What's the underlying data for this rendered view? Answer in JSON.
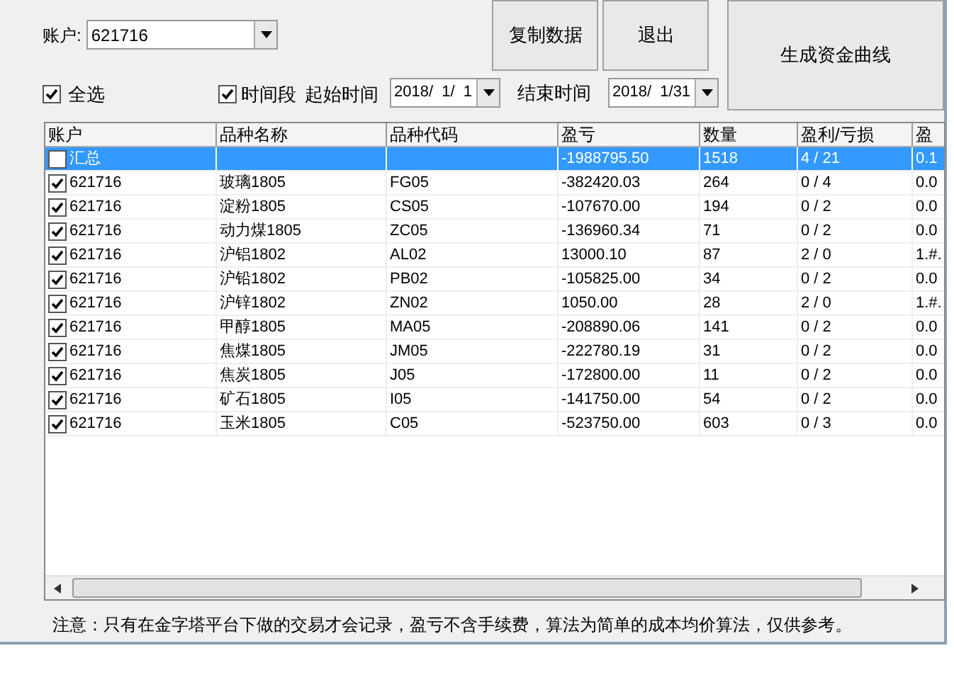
{
  "account": {
    "label": "账户:",
    "value": "621716"
  },
  "buttons": [
    {
      "label": "复制数据",
      "kind": "small"
    },
    {
      "label": "退出",
      "kind": "small"
    },
    {
      "label": "生成资金曲线",
      "kind": "large"
    }
  ],
  "select_all": {
    "label": "全选",
    "checked": true
  },
  "period": {
    "label": "时间段",
    "checked": true,
    "start_label": "起始时间",
    "start": "2018/  1/  1",
    "end_label": "结束时间",
    "end": "2018/  1/31"
  },
  "table": {
    "columns": [
      "账户",
      "品种名称",
      "品种代码",
      "盈亏",
      "数量",
      "盈利/亏损",
      "盈"
    ],
    "rows": [
      {
        "checked": false,
        "selected": true,
        "cells": [
          "汇总",
          "",
          "",
          "-1988795.50",
          "1518",
          "4 / 21",
          "0.1"
        ]
      },
      {
        "checked": true,
        "selected": false,
        "cells": [
          "621716",
          "玻璃1805",
          "FG05",
          "-382420.03",
          "264",
          "0 / 4",
          "0.0"
        ]
      },
      {
        "checked": true,
        "selected": false,
        "cells": [
          "621716",
          "淀粉1805",
          "CS05",
          "-107670.00",
          "194",
          "0 / 2",
          "0.0"
        ]
      },
      {
        "checked": true,
        "selected": false,
        "cells": [
          "621716",
          "动力煤1805",
          "ZC05",
          "-136960.34",
          "71",
          "0 / 2",
          "0.0"
        ]
      },
      {
        "checked": true,
        "selected": false,
        "cells": [
          "621716",
          "沪铝1802",
          "AL02",
          "13000.10",
          "87",
          "2 / 0",
          "1.#."
        ]
      },
      {
        "checked": true,
        "selected": false,
        "cells": [
          "621716",
          "沪铅1802",
          "PB02",
          "-105825.00",
          "34",
          "0 / 2",
          "0.0"
        ]
      },
      {
        "checked": true,
        "selected": false,
        "cells": [
          "621716",
          "沪锌1802",
          "ZN02",
          "1050.00",
          "28",
          "2 / 0",
          "1.#."
        ]
      },
      {
        "checked": true,
        "selected": false,
        "cells": [
          "621716",
          "甲醇1805",
          "MA05",
          "-208890.06",
          "141",
          "0 / 2",
          "0.0"
        ]
      },
      {
        "checked": true,
        "selected": false,
        "cells": [
          "621716",
          "焦煤1805",
          "JM05",
          "-222780.19",
          "31",
          "0 / 2",
          "0.0"
        ]
      },
      {
        "checked": true,
        "selected": false,
        "cells": [
          "621716",
          "焦炭1805",
          "J05",
          "-172800.00",
          "11",
          "0 / 2",
          "0.0"
        ]
      },
      {
        "checked": true,
        "selected": false,
        "cells": [
          "621716",
          "矿石1805",
          "I05",
          "-141750.00",
          "54",
          "0 / 2",
          "0.0"
        ]
      },
      {
        "checked": true,
        "selected": false,
        "cells": [
          "621716",
          "玉米1805",
          "C05",
          "-523750.00",
          "603",
          "0 / 3",
          "0.0"
        ]
      }
    ]
  },
  "note": "注意：只有在金字塔平台下做的交易才会记录，盈亏不含手续费，算法为简单的成本均价算法，仅供参考。"
}
